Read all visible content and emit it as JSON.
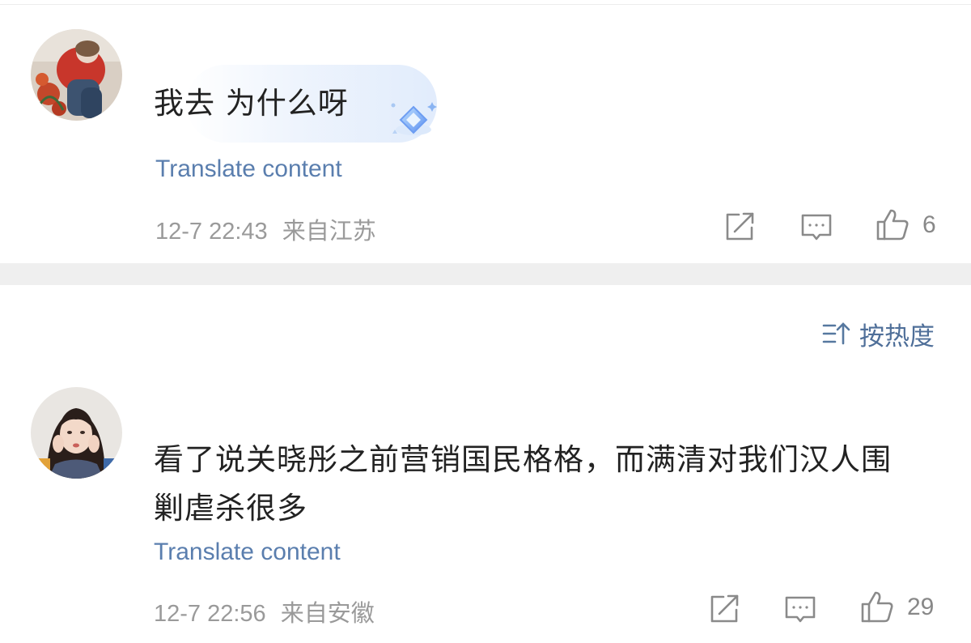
{
  "comments": [
    {
      "text": "我去 为什么呀",
      "translate_label": "Translate content",
      "timestamp": "12-7 22:43",
      "location": "来自江苏",
      "likes": "6"
    },
    {
      "text_line1": "看了说关晓彤之前营销国民格格，而满清对我们汉人围",
      "text_line2": "剿虐杀很多",
      "translate_label": "Translate content",
      "timestamp": "12-7 22:56",
      "location": "来自安徽",
      "likes": "29"
    }
  ],
  "sort": {
    "label": "按热度",
    "icon": "sort-icon"
  },
  "icons": {
    "share": "share-icon",
    "reply": "comment-icon",
    "like": "thumbs-up-icon",
    "badge": "diamond-badge-icon"
  },
  "colors": {
    "link": "#5a7eae",
    "meta": "#9a9a9a",
    "text": "#222222",
    "separator": "#efefef"
  }
}
